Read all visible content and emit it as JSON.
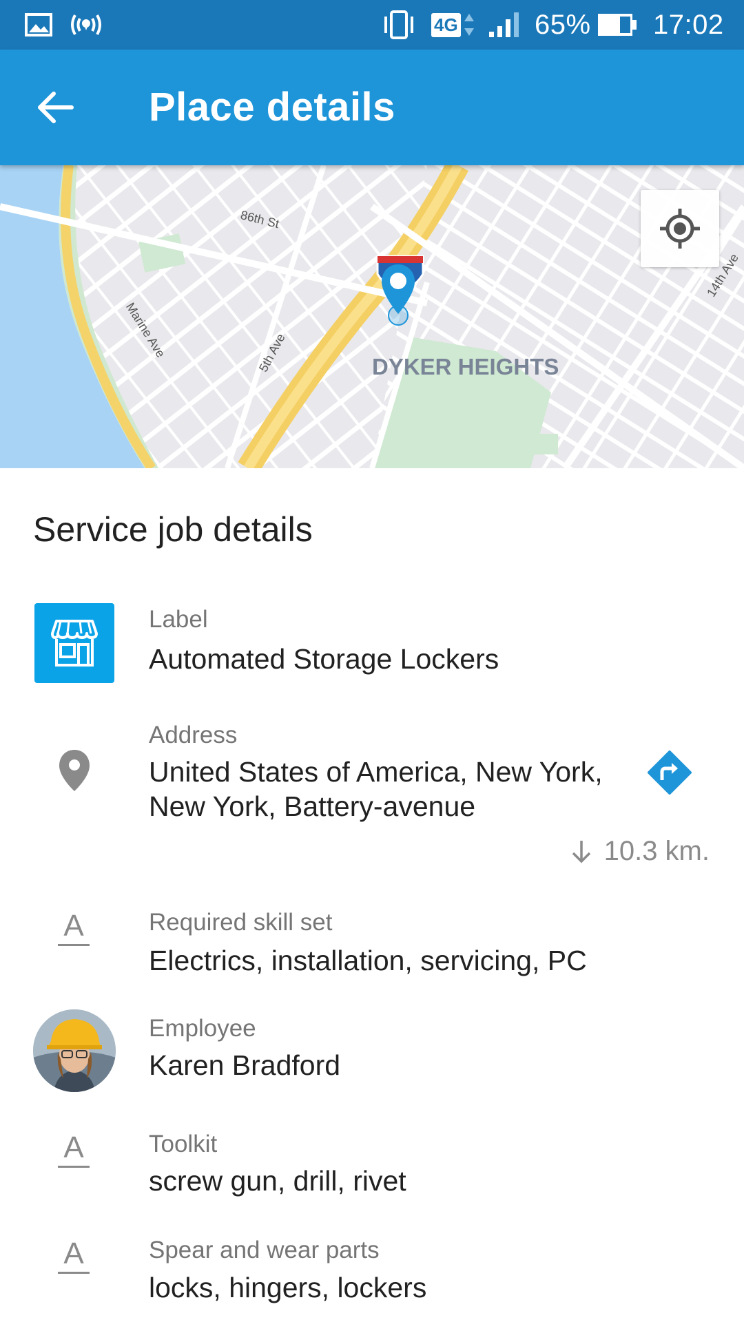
{
  "status_bar": {
    "battery": "65%",
    "time": "17:02",
    "network": "4G",
    "icons": [
      "gallery-icon",
      "hotspot-icon",
      "vibrate-icon",
      "network-4g-icon",
      "signal-icon",
      "battery-icon"
    ]
  },
  "app_bar": {
    "title": "Place details",
    "back_icon": "arrow-back-icon",
    "background": "#1e95d9"
  },
  "map": {
    "labels": {
      "street_86th": "86th St",
      "marine_ave": "Marine Ave",
      "fifth_ave": "5th Ave",
      "fourteenth_ave": "14th Ave",
      "neighborhood": "DYKER HEIGHTS"
    },
    "locate_icon": "my-location-icon",
    "pin_icon": "map-pin-icon",
    "accent": "#1e95d9"
  },
  "section": {
    "title": "Service job details"
  },
  "fields": {
    "label": {
      "caption": "Label",
      "value": "Automated Storage Lockers",
      "icon": "store-icon"
    },
    "address": {
      "caption": "Address",
      "value_line1": "United States of America, New York,",
      "value_line2": "New York, Battery-avenue",
      "icon": "location-pin-icon",
      "action_icon": "directions-icon"
    },
    "distance": {
      "value": "10.3 km.",
      "icon": "arrow-down-icon"
    },
    "skills": {
      "caption": "Required skill set",
      "value": "Electrics, installation, servicing, PC",
      "icon_glyph": "A"
    },
    "employee": {
      "caption": "Employee",
      "value": "Karen Bradford",
      "icon": "avatar"
    },
    "toolkit": {
      "caption": "Toolkit",
      "value": "screw gun, drill, rivet",
      "icon_glyph": "A"
    },
    "parts": {
      "caption": "Spear and wear parts",
      "value": "locks, hingers, lockers",
      "icon_glyph": "A"
    }
  }
}
